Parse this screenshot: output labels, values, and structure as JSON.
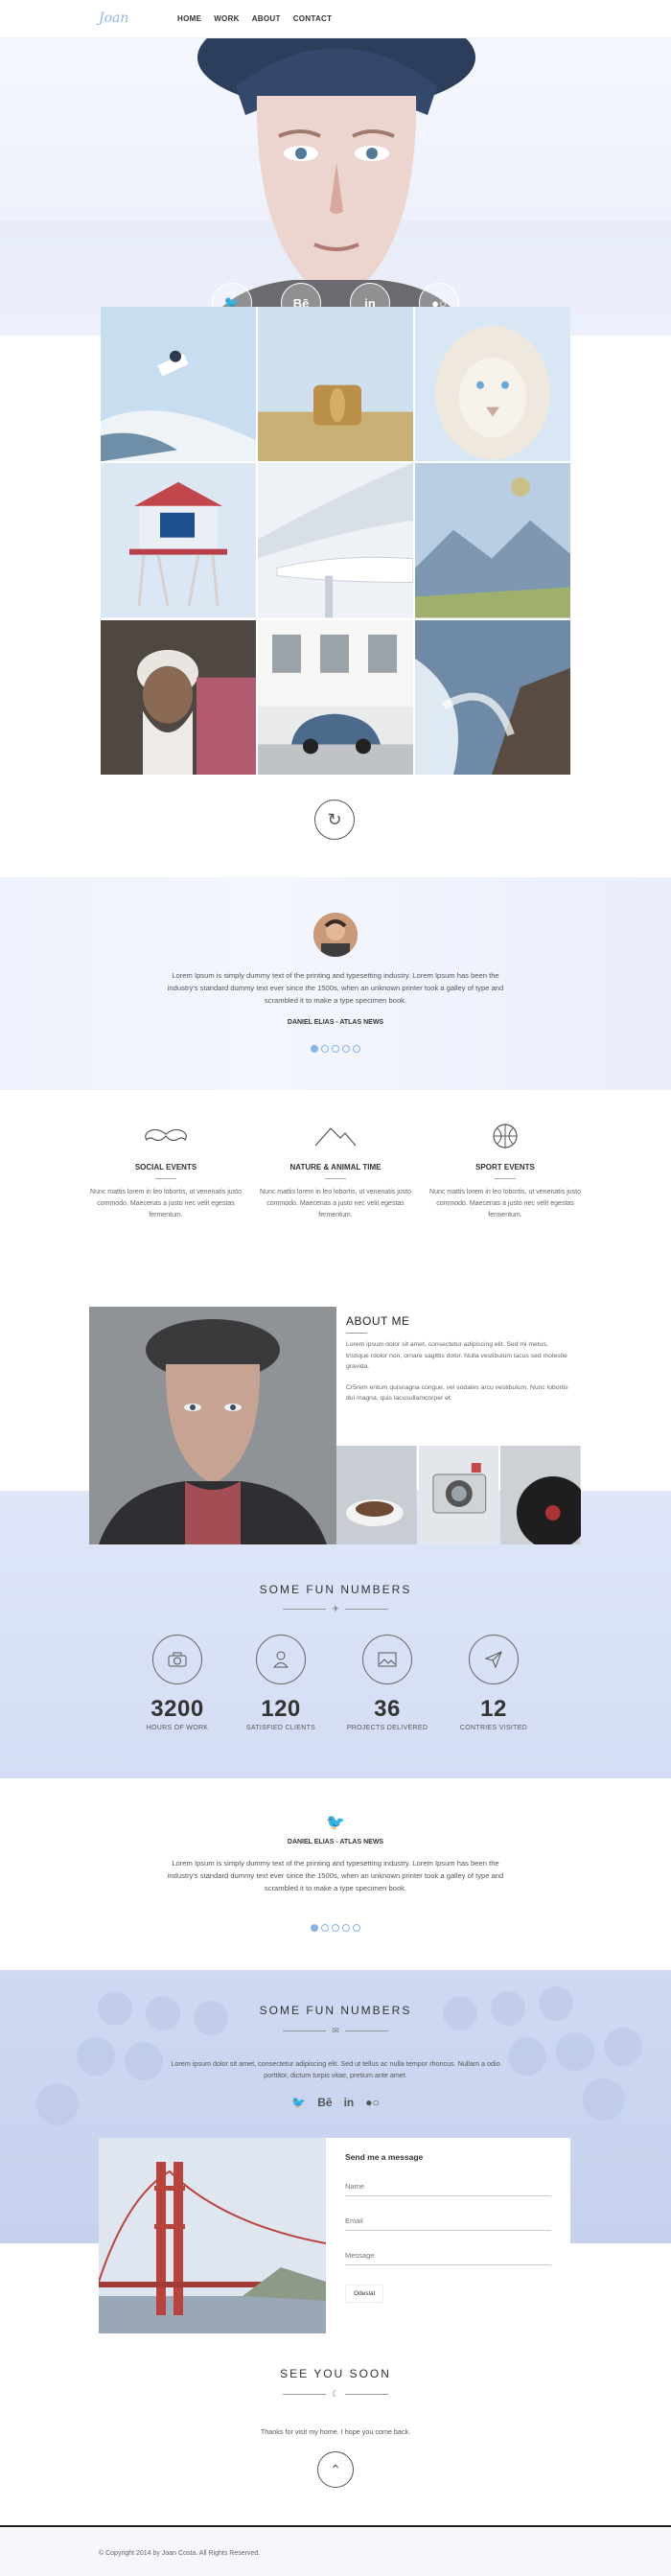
{
  "nav": {
    "logo": "Joan",
    "items": [
      "HOME",
      "WORK",
      "ABOUT",
      "CONTACT"
    ]
  },
  "hero": {
    "social": [
      {
        "icon": "twitter-icon",
        "glyph": "🐦"
      },
      {
        "icon": "behance-icon",
        "glyph": "Bē"
      },
      {
        "icon": "linkedin-icon",
        "glyph": "in"
      },
      {
        "icon": "flickr-icon",
        "glyph": "●○"
      }
    ]
  },
  "testimonial1": {
    "quote": "Lorem Ipsum is simply dummy text of the printing and typesetting industry. Lorem Ipsum has been the industry's standard dummy text ever since the 1500s, when an unknown printer took a galley of type and scrambled it to make a type specimen book.",
    "author": "DANIEL ELIAS - ATLAS NEWS",
    "active_dot": 0,
    "dot_count": 5
  },
  "features": [
    {
      "icon": "mustache-icon",
      "title": "SOCIAL EVENTS",
      "text": "Nunc mattis lorem in leo lobortis, ut venenatis justo commodo. Maecenas a justo nec velit egestas fermentum."
    },
    {
      "icon": "mountain-icon",
      "title": "NATURE & ANIMAL TIME",
      "text": "Nunc mattis lorem in leo lobortis, ut venenatis justo commodo. Maecenas a justo nec velit egestas fermentum."
    },
    {
      "icon": "ball-icon",
      "title": "SPORT EVENTS",
      "text": "Nunc mattis lorem in leo lobortis, ut venenatis justo commodo. Maecenas a justo nec velit egestas fermentum."
    }
  ],
  "about": {
    "title": "ABOUT ME",
    "p1": "Lorem ipsum dolor sit amet, consectetur adipiscing elit. Sed mi metus, tristique rdolor non, ornare sagittis dolor. Nulla vestibulum lacus sed molestie gravida.",
    "p2": "Cr5rem entum quisnagna congue, vel sodales arcu vestibulum. Nunc lobortis dui magna, quis lacusullamcorper et."
  },
  "fun_numbers": {
    "title": "SOME FUN NUMBERS",
    "stats": [
      {
        "icon": "camera-icon",
        "value": "3200",
        "label": "HOURS OF WORK"
      },
      {
        "icon": "user-icon",
        "value": "120",
        "label": "SATISFIED CLIENTS"
      },
      {
        "icon": "image-icon",
        "value": "36",
        "label": "PROJECTS DELIVERED"
      },
      {
        "icon": "paper-plane-icon",
        "value": "12",
        "label": "CONTRIES VISITED"
      }
    ]
  },
  "testimonial2": {
    "author": "DANIEL ELIAS - ATLAS NEWS",
    "quote": "Lorem Ipsum is simply dummy text of the printing and typesetting industry. Lorem Ipsum has been the industry's standard dummy text ever since the 1500s, when an unknown printer took a galley of type and scrambled it to make a type specimen book.",
    "active_dot": 0,
    "dot_count": 5
  },
  "contact": {
    "title": "SOME FUN NUMBERS",
    "text": "Lorem ipsum dolor sit amet, consectetur adipiscing elit. Sed ut tellus ac nulla tempor rhoncus. Nullam a odio porttitor, dictum turpis vitae, pretium ante amet.",
    "social": [
      "🐦",
      "Bē",
      "in",
      "●○"
    ],
    "form": {
      "heading": "Send me a message",
      "name_placeholder": "Name",
      "email_placeholder": "Email",
      "message_placeholder": "Message",
      "submit": "Odeslat"
    }
  },
  "farewell": {
    "title": "SEE YOU SOON",
    "text": "Thanks for visit my home. I hope you come back."
  },
  "footer": {
    "copyright": "© Copyright 2014 by Joan Costa. All Rights Reserved."
  }
}
